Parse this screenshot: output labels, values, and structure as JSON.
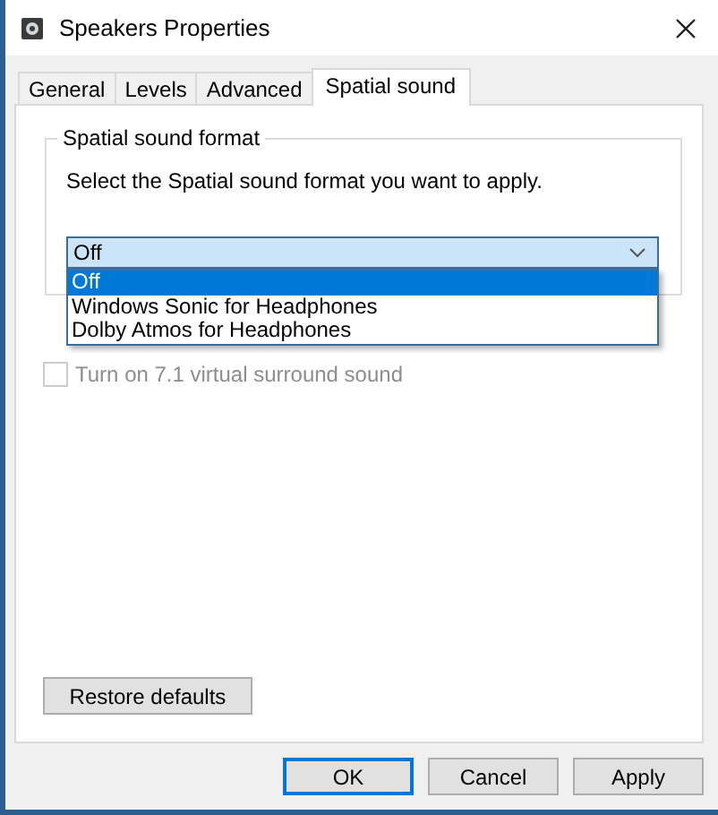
{
  "window": {
    "title": "Speakers Properties"
  },
  "tabs": [
    {
      "label": "General",
      "selected": false
    },
    {
      "label": "Levels",
      "selected": false
    },
    {
      "label": "Advanced",
      "selected": false
    },
    {
      "label": "Spatial sound",
      "selected": true
    }
  ],
  "group": {
    "title": "Spatial sound format",
    "description": "Select the Spatial sound format you want to apply.",
    "dropdown": {
      "value": "Off",
      "expanded": true,
      "options": [
        {
          "label": "Off",
          "selected": true
        },
        {
          "label": "Windows Sonic for Headphones",
          "selected": false
        },
        {
          "label": "Dolby Atmos for Headphones",
          "selected": false
        }
      ]
    }
  },
  "checkbox": {
    "label": "Turn on 7.1 virtual surround sound",
    "checked": false,
    "disabled": true
  },
  "restore_button": "Restore defaults",
  "buttons": [
    {
      "label": "OK",
      "default": true
    },
    {
      "label": "Cancel",
      "default": false
    },
    {
      "label": "Apply",
      "default": false
    }
  ]
}
